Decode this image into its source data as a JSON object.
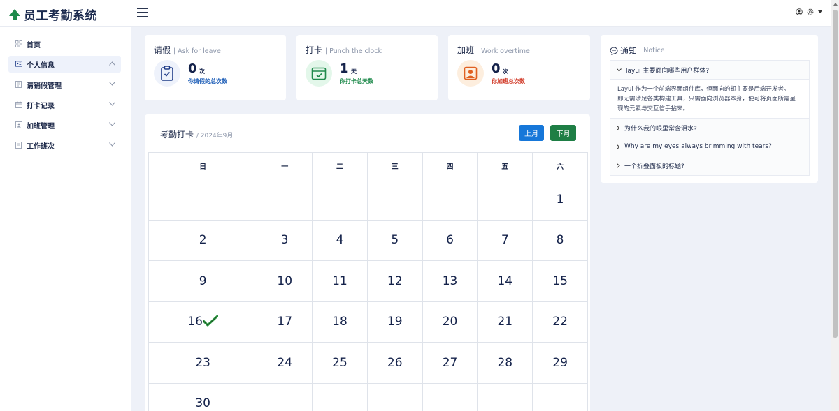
{
  "app": {
    "title": "员工考勤系统"
  },
  "sidebar": {
    "items": [
      {
        "label": "首页",
        "icon": "grid-icon",
        "expandable": false
      },
      {
        "label": "个人信息",
        "icon": "id-card-icon",
        "expandable": true,
        "expanded": true
      },
      {
        "label": "请销假管理",
        "icon": "document-icon",
        "expandable": true
      },
      {
        "label": "打卡记录",
        "icon": "calendar-icon",
        "expandable": true
      },
      {
        "label": "加班管理",
        "icon": "image-frame-icon",
        "expandable": true
      },
      {
        "label": "工作班次",
        "icon": "file-icon",
        "expandable": true
      }
    ]
  },
  "stats": {
    "leave": {
      "title": "请假",
      "subtitle": "Ask for leave",
      "value": "0",
      "unit": "次",
      "desc": "你请假的总次数",
      "color": "#1f5fb8",
      "bg": "#eef2fb"
    },
    "clock": {
      "title": "打卡",
      "subtitle": "Punch the clock",
      "value": "1",
      "unit": "天",
      "desc": "你打卡总天数",
      "color": "#1f8a4c",
      "bg": "#e3f7ea"
    },
    "overtime": {
      "title": "加班",
      "subtitle": "Work overtime",
      "value": "0",
      "unit": "次",
      "desc": "你加班总次数",
      "color": "#d23c2a",
      "bg": "#fdeede"
    }
  },
  "calendar": {
    "title": "考勤打卡",
    "subtitle": "2024年9月",
    "prev_label": "上月",
    "next_label": "下月",
    "weekdays": [
      "日",
      "一",
      "二",
      "三",
      "四",
      "五",
      "六"
    ],
    "weeks": [
      [
        "",
        "",
        "",
        "",
        "",
        "",
        "1"
      ],
      [
        "2",
        "3",
        "4",
        "5",
        "6",
        "7",
        "8"
      ],
      [
        "9",
        "10",
        "11",
        "12",
        "13",
        "14",
        "15"
      ],
      [
        "16",
        "17",
        "18",
        "19",
        "20",
        "21",
        "22"
      ],
      [
        "23",
        "24",
        "25",
        "26",
        "27",
        "28",
        "29"
      ],
      [
        "30",
        "",
        "",
        "",
        "",
        "",
        ""
      ]
    ],
    "checked_days": [
      "16"
    ]
  },
  "notice": {
    "title": "通知",
    "subtitle": "Notice",
    "items": [
      {
        "title": "layui 主要面向哪些用户群体?",
        "expanded": true,
        "body": [
          "Layui 作为一个前端界面组件库，但面向的却主要是后端开发者。",
          "即无需涉足各类构建工具，只需面向浏览器本身，便可将页面所需呈",
          "现的元素与交互信手拈来。"
        ]
      },
      {
        "title": "为什么我的眼里常含泪水?",
        "expanded": false
      },
      {
        "title": "Why are my eyes always brimming with tears?",
        "expanded": false
      },
      {
        "title": "一个折叠面板的标题?",
        "expanded": false
      }
    ]
  }
}
